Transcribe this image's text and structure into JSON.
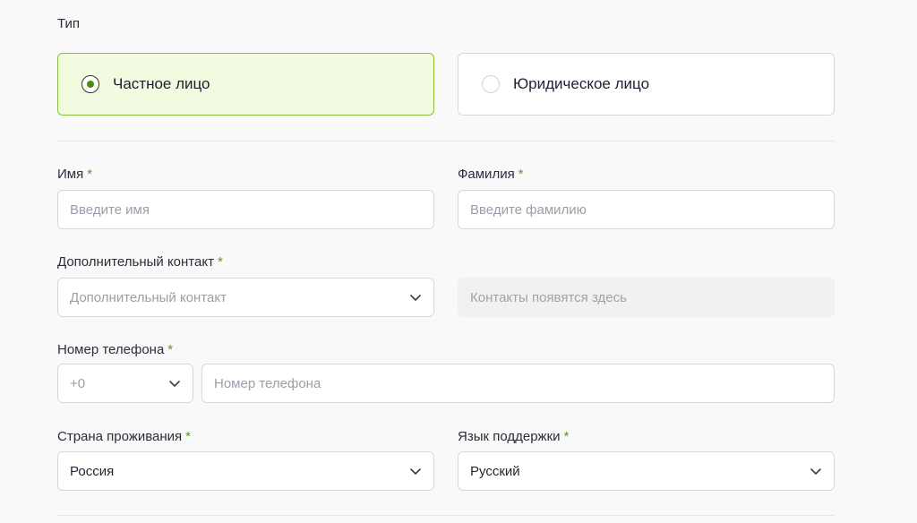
{
  "type_section": {
    "label": "Тип",
    "options": [
      {
        "label": "Частное лицо",
        "selected": true
      },
      {
        "label": "Юридическое лицо",
        "selected": false
      }
    ]
  },
  "form": {
    "required_mark": "*",
    "first_name": {
      "label": "Имя",
      "placeholder": "Введите имя"
    },
    "last_name": {
      "label": "Фамилия",
      "placeholder": "Введите фамилию"
    },
    "extra_contact": {
      "label": "Дополнительный контакт",
      "placeholder": "Дополнительный контакт",
      "icon": "chevron-down-icon"
    },
    "contacts_preview": {
      "text": "Контакты появятся здесь"
    },
    "phone": {
      "label": "Номер телефона",
      "code_value": "+0",
      "placeholder": "Номер телефона",
      "icon": "chevron-down-icon"
    },
    "country": {
      "label": "Страна проживания",
      "value": "Россия",
      "icon": "chevron-down-icon"
    },
    "support_language": {
      "label": "Язык поддержки",
      "value": "Русский",
      "icon": "chevron-down-icon"
    }
  },
  "colors": {
    "accent": "#86c13a",
    "accent_bg": "#f0fbdf",
    "required": "#5c9a1c",
    "border": "#d6d8dd",
    "page_bg": "#f9f9f9"
  }
}
